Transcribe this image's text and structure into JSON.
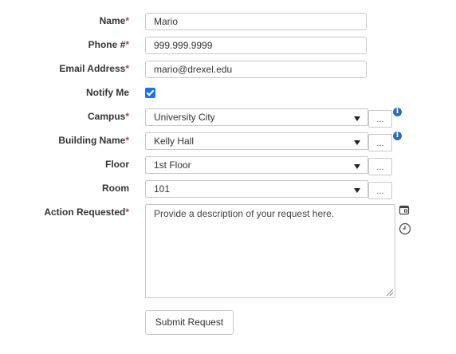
{
  "form": {
    "name": {
      "label": "Name",
      "required_mark": "*",
      "value": "Mario"
    },
    "phone": {
      "label": "Phone #",
      "required_mark": "*",
      "value": "999.999.9999"
    },
    "email": {
      "label": "Email Address",
      "required_mark": "*",
      "value": "mario@drexel.edu"
    },
    "notify": {
      "label": "Notify Me",
      "checked": true
    },
    "campus": {
      "label": "Campus",
      "required_mark": "*",
      "value": "University City",
      "lookup_label": "...",
      "info_glyph": "i"
    },
    "building": {
      "label": "Building Name",
      "required_mark": "*",
      "value": "Kelly Hall",
      "lookup_label": "...",
      "info_glyph": "i"
    },
    "floor": {
      "label": "Floor",
      "value": "1st Floor",
      "lookup_label": "..."
    },
    "room": {
      "label": "Room",
      "value": "101",
      "lookup_label": "..."
    },
    "action": {
      "label": "Action Requested",
      "required_mark": "*",
      "placeholder": "Provide a description of your request here."
    },
    "submit_label": "Submit Request"
  },
  "icons": {
    "info": "info-circle-icon",
    "template": "template-icon",
    "clock": "clock-icon",
    "caret": "caret-down-icon"
  },
  "colors": {
    "required": "#a94442",
    "info": "#2a6fb5",
    "checkbox": "#1a73e8",
    "border": "#c8c8c8"
  }
}
